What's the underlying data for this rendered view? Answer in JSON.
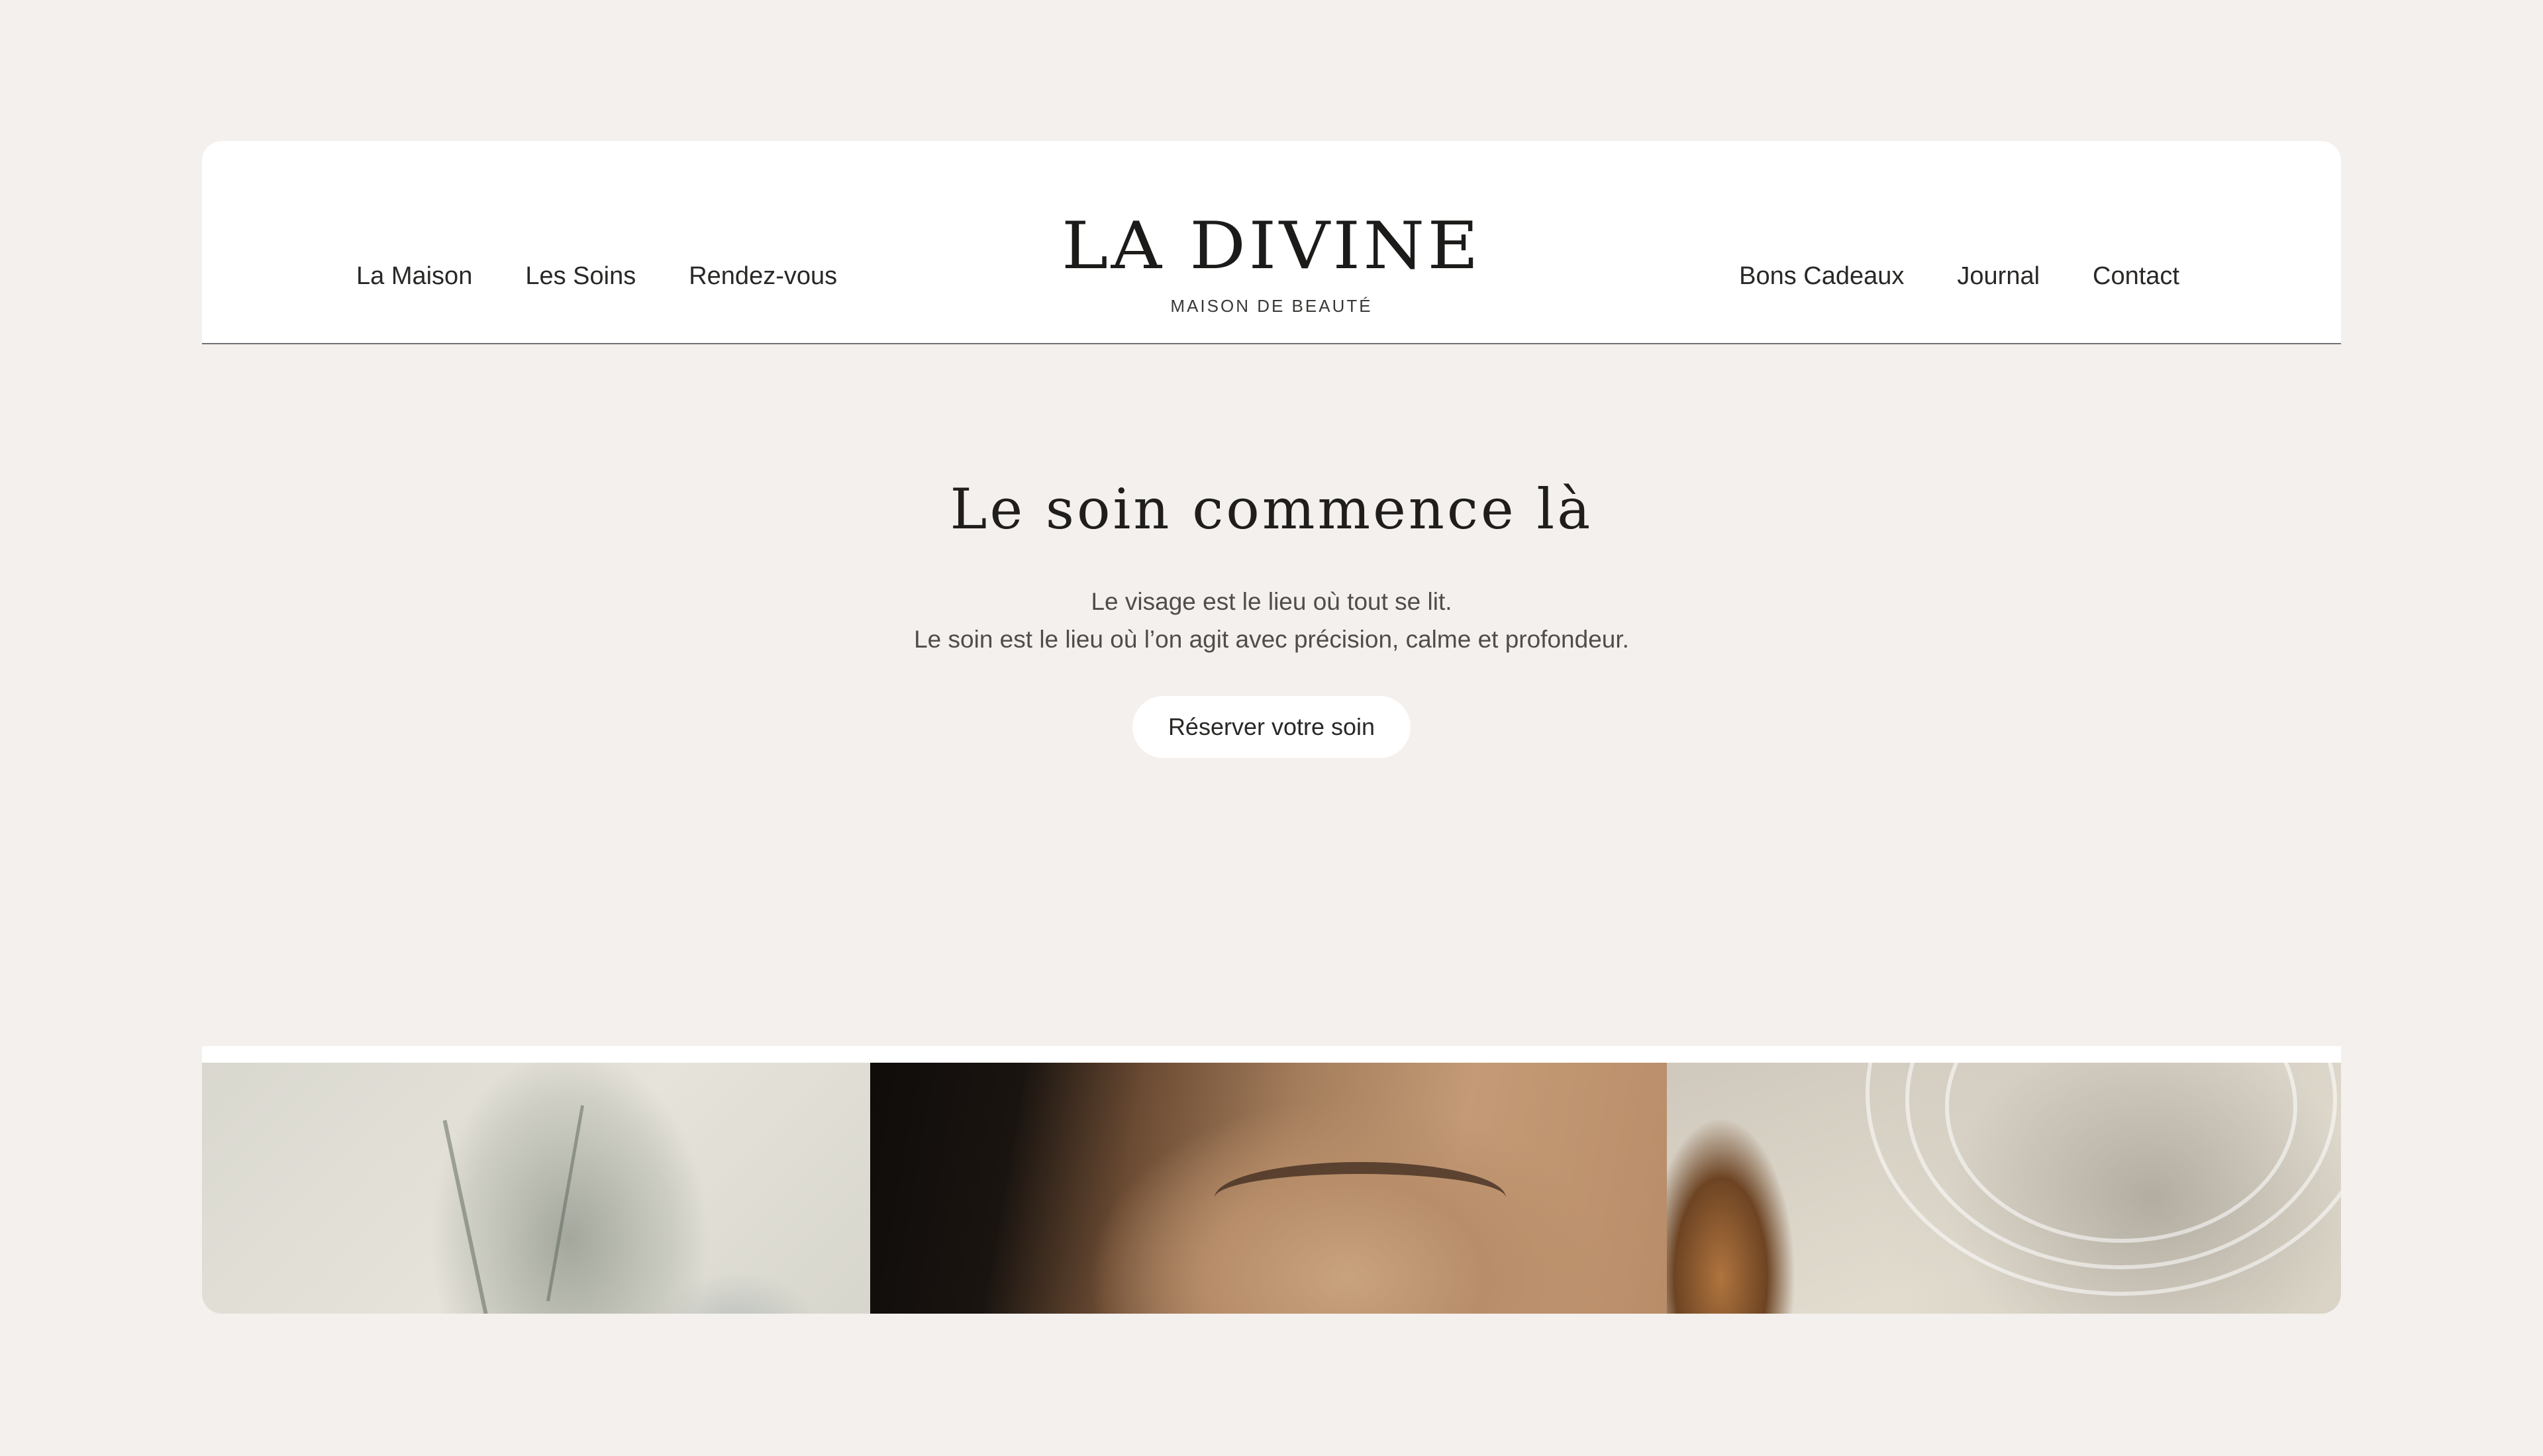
{
  "header": {
    "nav_left": [
      "La Maison",
      "Les Soins",
      "Rendez-vous"
    ],
    "nav_right": [
      "Bons Cadeaux",
      "Journal",
      "Contact"
    ],
    "logo": {
      "title": "LA DIVINE",
      "subtitle": "MAISON DE BEAUTÉ"
    }
  },
  "hero": {
    "title": "Le soin commence là",
    "lines": [
      "Le visage est le lieu où tout se lit.",
      "Le soin est le lieu où l’on agit avec précision, calme et profondeur."
    ],
    "cta_label": "Réserver votre soin"
  },
  "gallery": {
    "images": [
      {
        "name": "dried-flower-shadow-photo"
      },
      {
        "name": "closed-eye-skincare-photo"
      },
      {
        "name": "glass-and-oil-photo"
      }
    ]
  },
  "colors": {
    "background": "#f3f0ed",
    "card": "#ffffff",
    "text": "#2a2826",
    "divider": "#6f7378"
  }
}
